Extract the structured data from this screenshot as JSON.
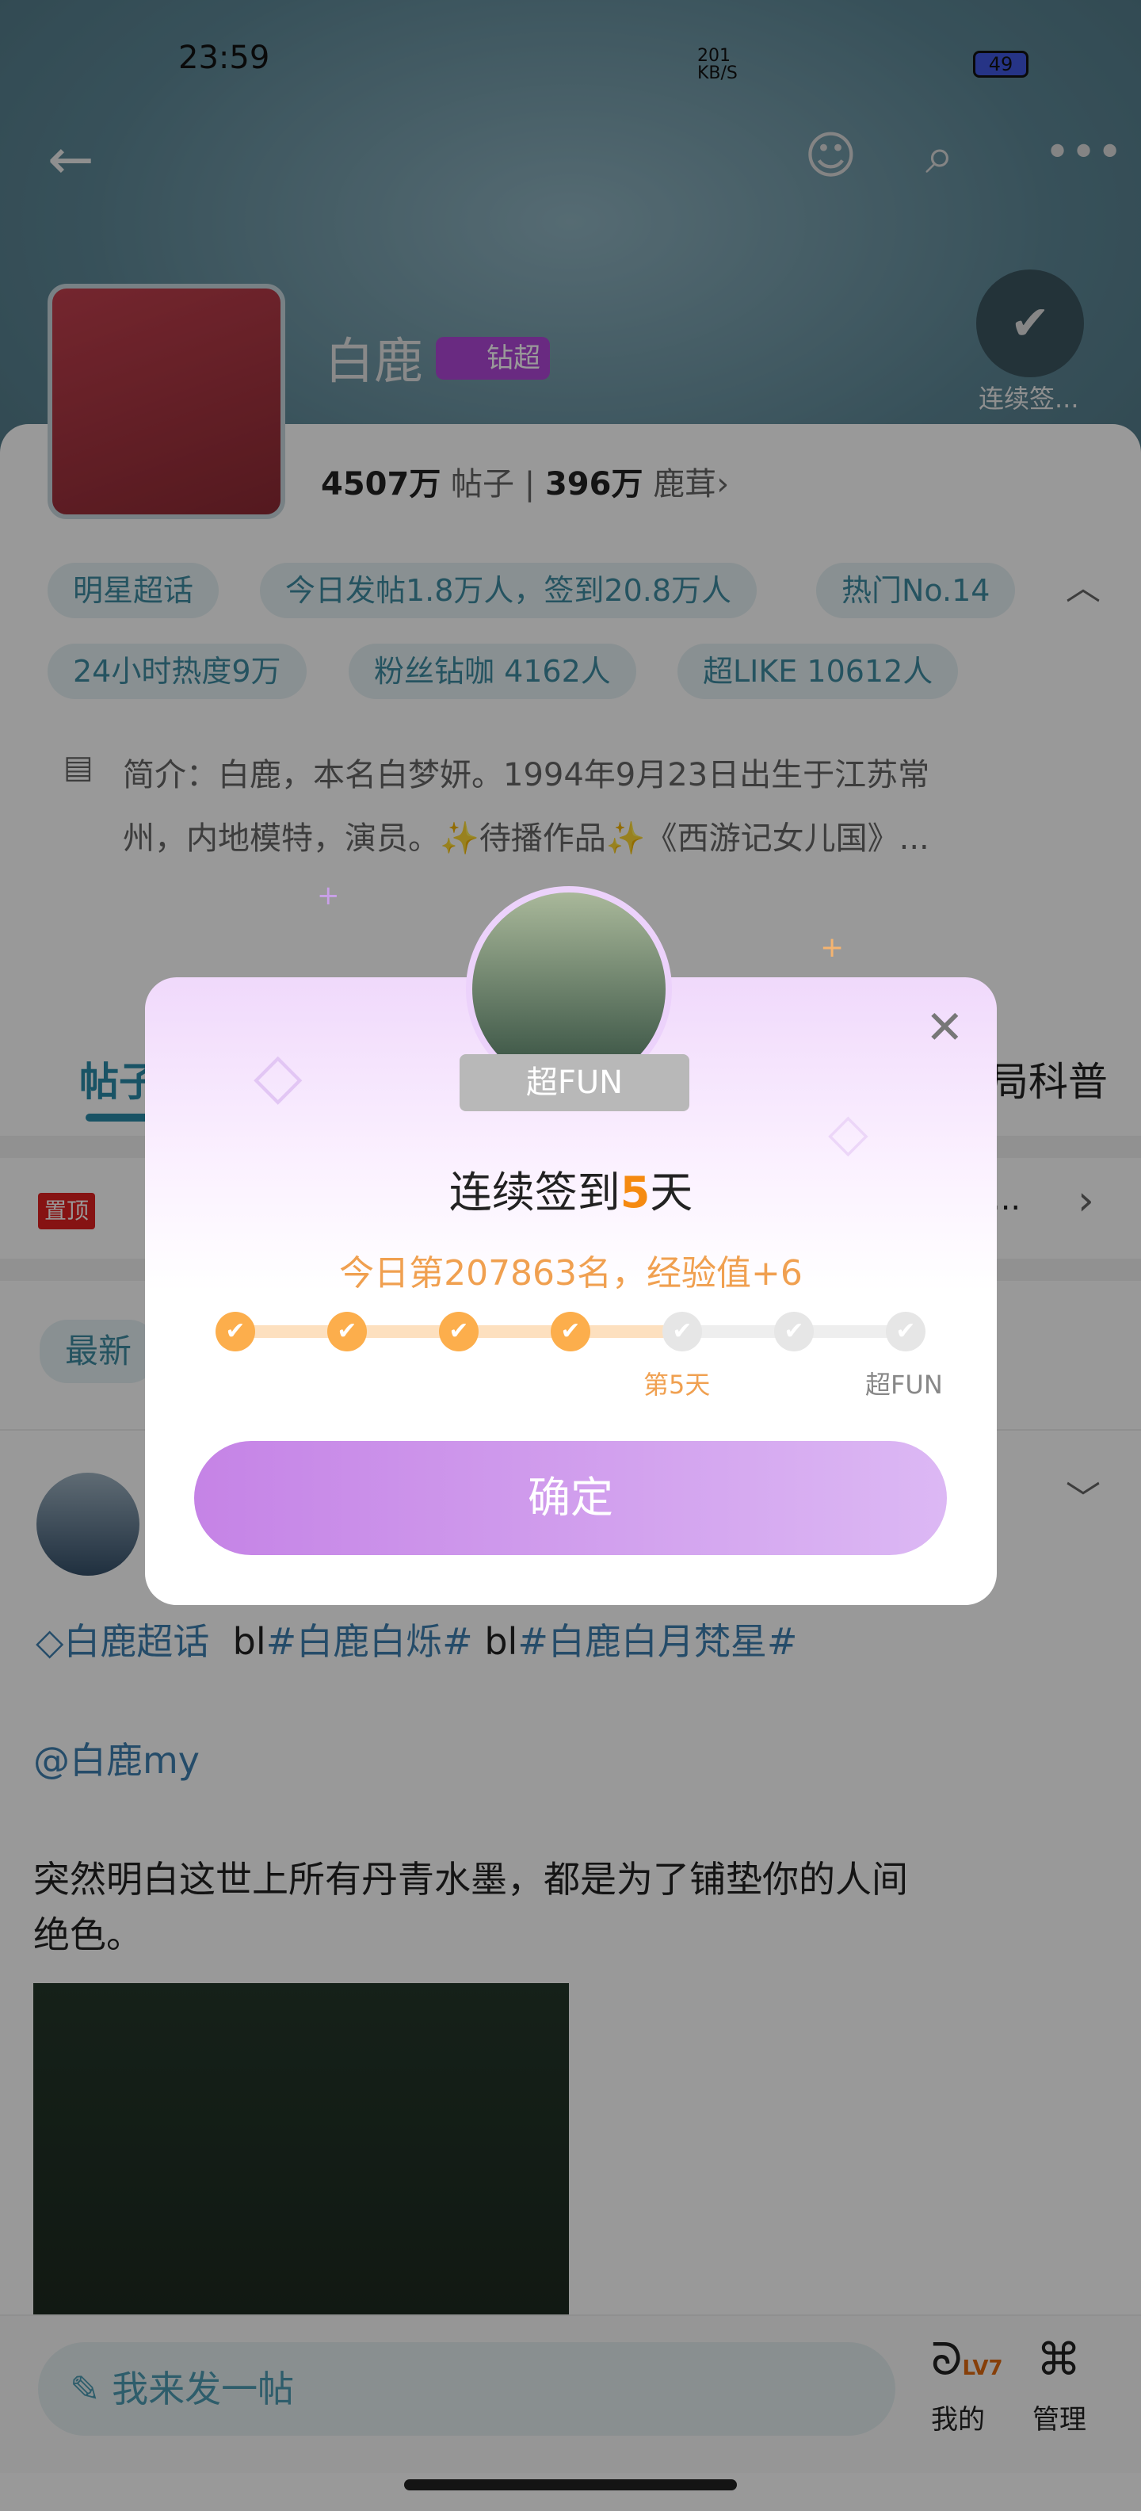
{
  "status_bar": {
    "time": "23:59",
    "net_speed": "201 KB/S",
    "battery": "49"
  },
  "header": {
    "name": "白鹿",
    "badge": "钻超",
    "checkin_label": "连续签...",
    "posts_count": "4507万",
    "posts_label": "帖子",
    "fans_count": "396万",
    "fans_label": "鹿茸"
  },
  "tags": [
    "明星超话",
    "今日发帖1.8万人，签到20.8万人",
    "热门No.14",
    "24小时热度9万",
    "粉丝钻咖 4162人",
    "超LIKE 10612人"
  ],
  "intro": {
    "line1": "简介：白鹿，本名白梦妍。1994年9月23日出生于江苏常",
    "line2": "州，内地模特，演员。✨待播作品✨《西游记女儿国》..."
  },
  "tabs": {
    "first": "帖子",
    "last": "局科普"
  },
  "pinned": {
    "badge": "置顶",
    "more": "..."
  },
  "filter": {
    "first": "最新"
  },
  "post": {
    "topic": "白鹿超话",
    "tag_prefix1": "bl",
    "tag1": "#白鹿白烁#",
    "tag_prefix2": "bl",
    "tag2": "#白鹿白月梵星#",
    "mention": "@白鹿my",
    "text1": "突然明白这世上所有丹青水墨，都是为了铺垫你的人间",
    "text2": "绝色。"
  },
  "bottom_bar": {
    "compose_placeholder": "我来发一帖",
    "mine_label": "我的",
    "level": "LV7",
    "manage_label": "管理"
  },
  "modal": {
    "badge": "超FUN",
    "title_prefix": "连续签到",
    "title_days": "5",
    "title_suffix": "天",
    "subtitle": "今日第207863名，经验值+6",
    "progress_days_done": 4,
    "progress_total": 7,
    "label_day5": "第5天",
    "label_end": "超FUN",
    "confirm": "确定",
    "accent": "#fcae4c",
    "button_color": "#c88ae6"
  }
}
